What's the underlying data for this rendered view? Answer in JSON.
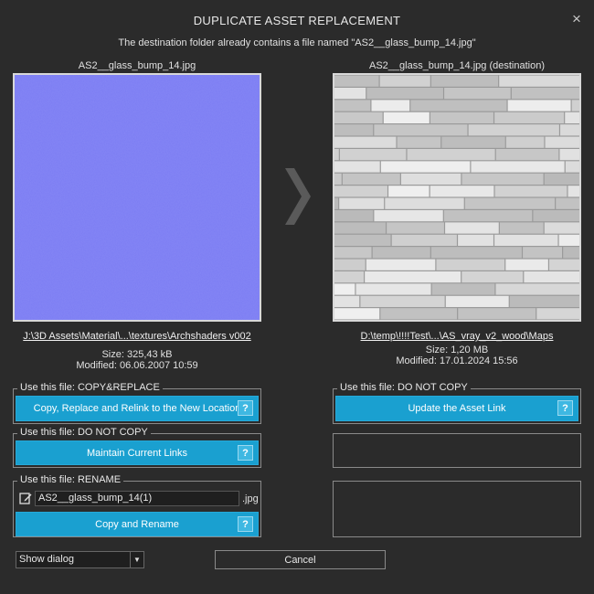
{
  "dialog": {
    "title": "DUPLICATE ASSET REPLACEMENT",
    "close_glyph": "×",
    "message": "The destination folder already contains a file named \"AS2__glass_bump_14.jpg\""
  },
  "source": {
    "title": "AS2__glass_bump_14.jpg",
    "path": "J:\\3D Assets\\Material\\...\\textures\\Archshaders v002",
    "size": "Size: 325,43 kB",
    "modified": "Modified: 06.06.2007 10:59",
    "preview_color": "#7b7cf3"
  },
  "destination": {
    "title": "AS2__glass_bump_14.jpg (destination)",
    "path": "D:\\temp\\!!!!Test\\...\\AS_vray_v2_wood\\Maps",
    "size": "Size: 1,20 MB",
    "modified": "Modified: 17.01.2024 15:56"
  },
  "options": {
    "copy_replace": {
      "legend": "Use this file: COPY&REPLACE",
      "button": "Copy, Replace and Relink to the New Location",
      "help": "?"
    },
    "do_not_copy_left": {
      "legend": "Use this file: DO NOT COPY",
      "button": "Maintain Current Links",
      "help": "?"
    },
    "rename": {
      "legend": "Use this file: RENAME",
      "input_value": "AS2__glass_bump_14(1)",
      "extension": ".jpg",
      "button": "Copy and Rename",
      "help": "?"
    },
    "do_not_copy_right": {
      "legend": "Use this file: DO NOT COPY",
      "button": "Update the Asset Link",
      "help": "?"
    }
  },
  "footer": {
    "dropdown_value": "Show dialog",
    "cancel_label": "Cancel"
  },
  "colors": {
    "accent": "#1aa0d0",
    "background": "#2b2b2b"
  }
}
